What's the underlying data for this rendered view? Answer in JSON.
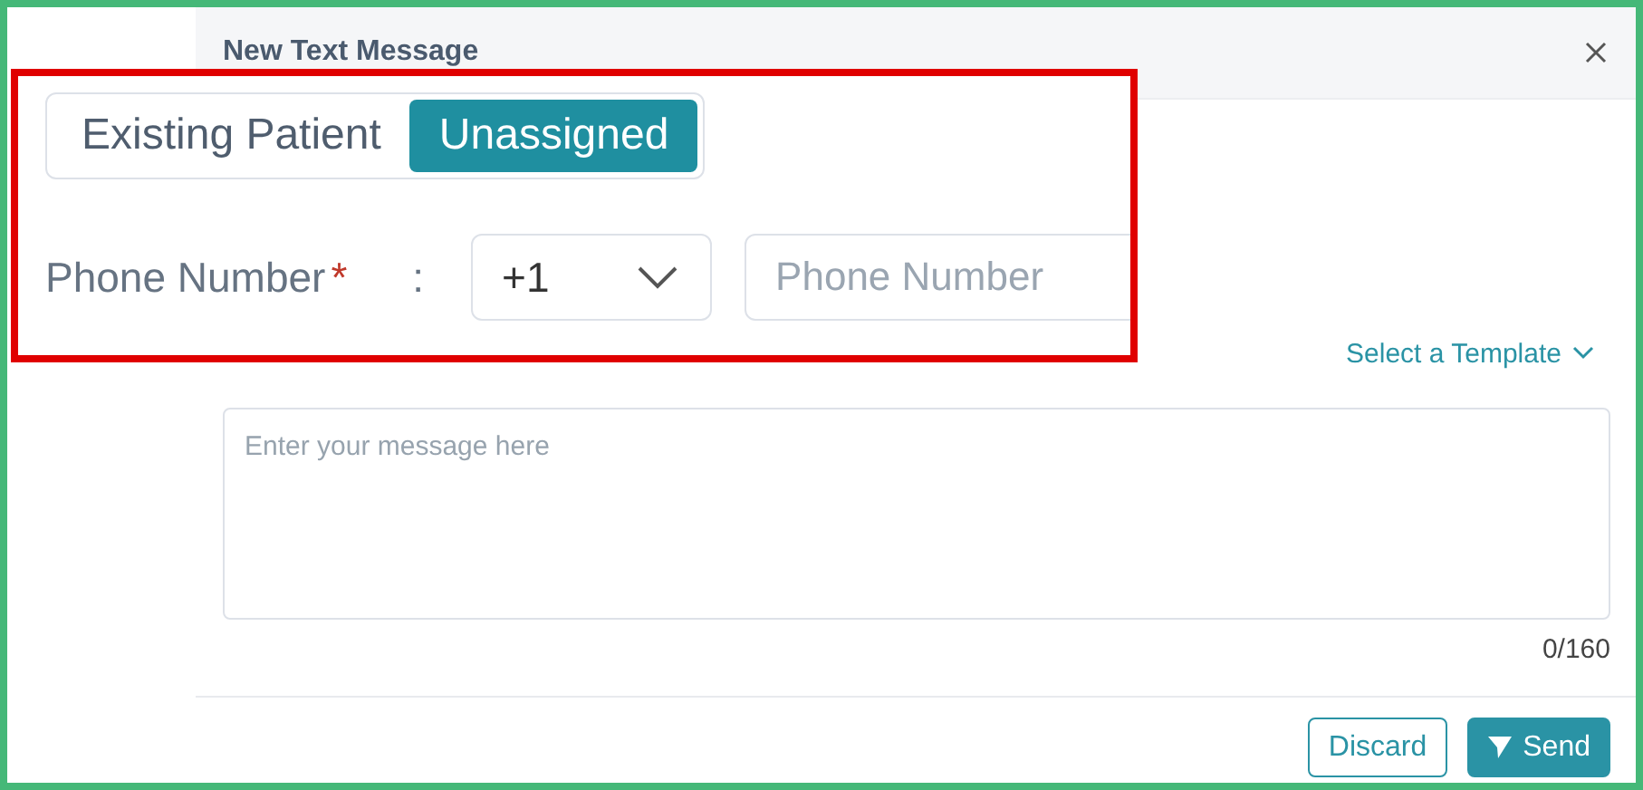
{
  "dialog": {
    "title": "New Text Message"
  },
  "template_picker": {
    "label": "Select a Template"
  },
  "message": {
    "placeholder": "Enter your message here",
    "counter": "0/160"
  },
  "buttons": [
    {
      "kind": "outline",
      "label": "Discard"
    },
    {
      "kind": "primary",
      "label": "Send"
    }
  ],
  "callout": {
    "toggle": [
      {
        "label": "Existing Patient",
        "selected": false
      },
      {
        "label": "Unassigned",
        "selected": true
      }
    ],
    "phone": {
      "label": "Phone Number",
      "required_mark": "*",
      "separator": ":",
      "country_code": "+1",
      "placeholder": "Phone Number"
    }
  }
}
